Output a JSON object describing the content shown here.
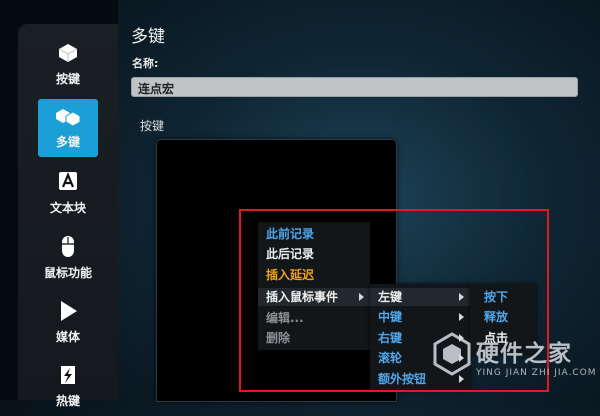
{
  "sidebar": {
    "items": [
      {
        "label": "按键",
        "icon": "key-icon",
        "active": false
      },
      {
        "label": "多键",
        "icon": "multi-key-icon",
        "active": true
      },
      {
        "label": "文本块",
        "icon": "text-block-icon",
        "active": false
      },
      {
        "label": "鼠标功能",
        "icon": "mouse-icon",
        "active": false
      },
      {
        "label": "媒体",
        "icon": "play-icon",
        "active": false
      },
      {
        "label": "热键",
        "icon": "hotkey-icon",
        "active": false
      }
    ]
  },
  "main": {
    "title": "多键",
    "name_label": "名称:",
    "name_value": "连点宏",
    "keys_label": "按键"
  },
  "context_menu": {
    "items": [
      {
        "label": "此前记录",
        "style": "blue"
      },
      {
        "label": "此后记录",
        "style": "white"
      },
      {
        "label": "插入延迟",
        "style": "orange"
      },
      {
        "label": "插入鼠标事件",
        "style": "white",
        "submenu": true
      },
      {
        "label": "编辑...",
        "style": "gray"
      },
      {
        "label": "删除",
        "style": "gray"
      }
    ]
  },
  "mouse_submenu": {
    "items": [
      {
        "label": "左键",
        "style": "white",
        "submenu": true
      },
      {
        "label": "中键",
        "style": "blue",
        "submenu": true
      },
      {
        "label": "右键",
        "style": "blue",
        "submenu": true
      },
      {
        "label": "滚轮",
        "style": "blue",
        "submenu": true
      },
      {
        "label": "额外按钮",
        "style": "blue",
        "submenu": true
      }
    ]
  },
  "button_submenu": {
    "items": [
      {
        "label": "按下",
        "style": "blue"
      },
      {
        "label": "释放",
        "style": "blue"
      },
      {
        "label": "点击",
        "style": "white"
      }
    ]
  },
  "watermark": {
    "text": "硬件之家",
    "url": "YING JIAN ZHI JIA.COM"
  },
  "colors": {
    "accent": "#1c9fd6",
    "highlight_box": "#e11a22",
    "menu_blue": "#4fa6ea",
    "menu_orange": "#f0a21c"
  }
}
